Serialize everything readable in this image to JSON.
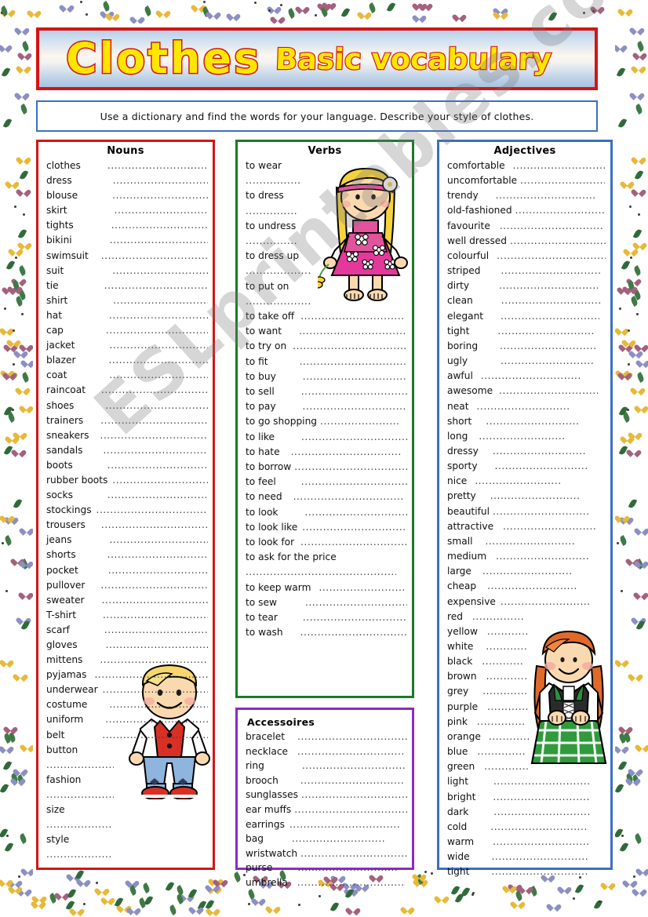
{
  "title": {
    "main": "Clothes",
    "sub": "Basic vocabulary"
  },
  "instruction": {
    "text": "Use a dictionary and find the words for your language.  Describe your style of clothes."
  },
  "watermark": {
    "text": "ESLprintables.com"
  },
  "colors": {
    "title_border": "#d31515",
    "title_fill": "#ffe600",
    "instruction_border": "#3b6fc4",
    "nouns_border": "#d31515",
    "verbs_border": "#1a7a28",
    "accessoires_border": "#8a2bc9",
    "adjectives_border": "#3b6fc4"
  },
  "columns": {
    "nouns": {
      "heading": "Nouns",
      "items": [
        {
          "word": "clothes",
          "gap": 34,
          "dots": 180,
          "wrap": false
        },
        {
          "word": "dress",
          "gap": 52,
          "dots": 170,
          "wrap": false
        },
        {
          "word": "blouse",
          "gap": 44,
          "dots": 168,
          "wrap": false
        },
        {
          "word": "skirt",
          "gap": 60,
          "dots": 168,
          "wrap": false
        },
        {
          "word": "tights",
          "gap": 48,
          "dots": 168,
          "wrap": false
        },
        {
          "word": "bikini",
          "gap": 48,
          "dots": 164,
          "wrap": false
        },
        {
          "word": "swimsuit",
          "gap": 16,
          "dots": 182,
          "wrap": false
        },
        {
          "word": "suit",
          "gap": 62,
          "dots": 163,
          "wrap": false
        },
        {
          "word": "tie",
          "gap": 58,
          "dots": 166,
          "wrap": false
        },
        {
          "word": "shirt",
          "gap": 58,
          "dots": 166,
          "wrap": false
        },
        {
          "word": "hat",
          "gap": 60,
          "dots": 164,
          "wrap": false
        },
        {
          "word": "cap",
          "gap": 54,
          "dots": 164,
          "wrap": false
        },
        {
          "word": "jacket",
          "gap": 44,
          "dots": 164,
          "wrap": false
        },
        {
          "word": "blazer",
          "gap": 42,
          "dots": 164,
          "wrap": false
        },
        {
          "word": "coat",
          "gap": 54,
          "dots": 164,
          "wrap": false
        },
        {
          "word": "raincoat",
          "gap": 20,
          "dots": 178,
          "wrap": false
        },
        {
          "word": "shoes",
          "gap": 40,
          "dots": 170,
          "wrap": false
        },
        {
          "word": "trainers",
          "gap": 22,
          "dots": 175,
          "wrap": false
        },
        {
          "word": "sneakers",
          "gap": 14,
          "dots": 178,
          "wrap": false
        },
        {
          "word": "sandals",
          "gap": 26,
          "dots": 172,
          "wrap": false
        },
        {
          "word": "boots",
          "gap": 44,
          "dots": 164,
          "wrap": false
        },
        {
          "word": "rubber boots",
          "gap": 6,
          "dots": 150,
          "wrap": false
        },
        {
          "word": "socks",
          "gap": 44,
          "dots": 160,
          "wrap": false
        },
        {
          "word": "stockings",
          "gap": 6,
          "dots": 178,
          "wrap": false
        },
        {
          "word": "trousers",
          "gap": 20,
          "dots": 176,
          "wrap": false
        },
        {
          "word": "jeans",
          "gap": 48,
          "dots": 164,
          "wrap": false
        },
        {
          "word": "shorts",
          "gap": 40,
          "dots": 164,
          "wrap": false
        },
        {
          "word": "pocket",
          "gap": 38,
          "dots": 164,
          "wrap": false
        },
        {
          "word": "pullover",
          "gap": 20,
          "dots": 170,
          "wrap": false
        },
        {
          "word": "sweater",
          "gap": 22,
          "dots": 170,
          "wrap": false
        },
        {
          "word": "T-shirt",
          "gap": 34,
          "dots": 164,
          "wrap": false
        },
        {
          "word": "scarf",
          "gap": 44,
          "dots": 162,
          "wrap": false
        },
        {
          "word": "gloves",
          "gap": 36,
          "dots": 162,
          "wrap": false
        },
        {
          "word": "mittens",
          "gap": 22,
          "dots": 166,
          "wrap": false
        },
        {
          "word": "pyjamas",
          "gap": 10,
          "dots": 172,
          "wrap": false
        },
        {
          "word": "underwear",
          "gap": 6,
          "dots": 174,
          "wrap": false
        },
        {
          "word": "costume",
          "gap": 28,
          "dots": 170,
          "wrap": false
        },
        {
          "word": "uniform",
          "gap": 28,
          "dots": 172,
          "wrap": false
        },
        {
          "word": "belt",
          "gap": 48,
          "dots": 170,
          "wrap": false
        },
        {
          "word": "button",
          "gap": 0,
          "dots": 86,
          "wrap": true
        },
        {
          "word": "fashion",
          "gap": 0,
          "dots": 86,
          "wrap": true
        },
        {
          "word": "size",
          "gap": 0,
          "dots": 82,
          "wrap": true
        },
        {
          "word": "style",
          "gap": 0,
          "dots": 82,
          "wrap": true
        }
      ]
    },
    "verbs": {
      "heading": "Verbs",
      "items": [
        {
          "word": "to wear",
          "gap": 0,
          "dots": 72,
          "wrap": true
        },
        {
          "word": "to dress",
          "gap": 0,
          "dots": 66,
          "wrap": true
        },
        {
          "word": "to undress",
          "gap": 0,
          "dots": 66,
          "wrap": true
        },
        {
          "word": "to dress up",
          "gap": 0,
          "dots": 82,
          "wrap": true
        },
        {
          "word": "to put on",
          "gap": 0,
          "dots": 82,
          "wrap": true
        },
        {
          "word": "to take off",
          "gap": 8,
          "dots": 134,
          "wrap": false
        },
        {
          "word": "to want",
          "gap": 22,
          "dots": 138,
          "wrap": false
        },
        {
          "word": "to try on",
          "gap": 8,
          "dots": 146,
          "wrap": false
        },
        {
          "word": "to fit",
          "gap": 40,
          "dots": 142,
          "wrap": false
        },
        {
          "word": "to buy",
          "gap": 34,
          "dots": 136,
          "wrap": false
        },
        {
          "word": "to sell",
          "gap": 34,
          "dots": 136,
          "wrap": false
        },
        {
          "word": "to pay",
          "gap": 34,
          "dots": 140,
          "wrap": false
        },
        {
          "word": "to go shopping",
          "gap": 4,
          "dots": 100,
          "wrap": false
        },
        {
          "word": "to like",
          "gap": 34,
          "dots": 136,
          "wrap": false
        },
        {
          "word": "to hate",
          "gap": 14,
          "dots": 140,
          "wrap": false
        },
        {
          "word": "to borrow",
          "gap": 4,
          "dots": 150,
          "wrap": false
        },
        {
          "word": "to feel",
          "gap": 32,
          "dots": 140,
          "wrap": false
        },
        {
          "word": "to need",
          "gap": 14,
          "dots": 142,
          "wrap": false
        },
        {
          "word": "to look",
          "gap": 34,
          "dots": 136,
          "wrap": false
        },
        {
          "word": "to look like",
          "gap": 6,
          "dots": 148,
          "wrap": false
        },
        {
          "word": "to look for",
          "gap": 8,
          "dots": 144,
          "wrap": false
        },
        {
          "word": "to ask for the price",
          "gap": 0,
          "dots": 192,
          "wrap": true
        },
        {
          "word": "to keep warm",
          "gap": 10,
          "dots": 112,
          "wrap": false
        },
        {
          "word": "to sew",
          "gap": 36,
          "dots": 136,
          "wrap": false
        },
        {
          "word": "to tear",
          "gap": 32,
          "dots": 142,
          "wrap": false
        },
        {
          "word": "to wash",
          "gap": 22,
          "dots": 140,
          "wrap": false
        }
      ]
    },
    "accessoires": {
      "heading": "Accessoires",
      "items": [
        {
          "word": "bracelet",
          "gap": 16,
          "dots": 140,
          "wrap": false
        },
        {
          "word": "necklace",
          "gap": 12,
          "dots": 136,
          "wrap": false
        },
        {
          "word": "ring",
          "gap": 48,
          "dots": 132,
          "wrap": false
        },
        {
          "word": "brooch",
          "gap": 28,
          "dots": 132,
          "wrap": false
        },
        {
          "word": "sunglasses",
          "gap": 4,
          "dots": 140,
          "wrap": false
        },
        {
          "word": "ear muffs",
          "gap": 4,
          "dots": 148,
          "wrap": false
        },
        {
          "word": "earrings",
          "gap": 6,
          "dots": 142,
          "wrap": false
        },
        {
          "word": "bag",
          "gap": 36,
          "dots": 120,
          "wrap": false
        },
        {
          "word": "wristwatch",
          "gap": 4,
          "dots": 148,
          "wrap": false
        },
        {
          "word": "purse",
          "gap": 32,
          "dots": 128,
          "wrap": false
        },
        {
          "word": "umbrella",
          "gap": 12,
          "dots": 136,
          "wrap": false
        }
      ]
    },
    "adjectives": {
      "heading": "Adjectives",
      "items": [
        {
          "word": "comfortable",
          "gap": 10,
          "dots": 118,
          "wrap": false
        },
        {
          "word": "uncomfortable",
          "gap": 4,
          "dots": 108,
          "wrap": false
        },
        {
          "word": "trendy",
          "gap": 22,
          "dots": 128,
          "wrap": false
        },
        {
          "word": "old-fashioned",
          "gap": 4,
          "dots": 114,
          "wrap": false
        },
        {
          "word": "favourite",
          "gap": 12,
          "dots": 132,
          "wrap": false
        },
        {
          "word": "well dressed",
          "gap": 4,
          "dots": 126,
          "wrap": false
        },
        {
          "word": "colourful",
          "gap": 10,
          "dots": 140,
          "wrap": false
        },
        {
          "word": "striped",
          "gap": 26,
          "dots": 128,
          "wrap": false
        },
        {
          "word": "dirty",
          "gap": 38,
          "dots": 126,
          "wrap": false
        },
        {
          "word": "clean",
          "gap": 36,
          "dots": 126,
          "wrap": false
        },
        {
          "word": "elegant",
          "gap": 22,
          "dots": 126,
          "wrap": false
        },
        {
          "word": "tight",
          "gap": 36,
          "dots": 124,
          "wrap": false
        },
        {
          "word": "boring",
          "gap": 28,
          "dots": 124,
          "wrap": false
        },
        {
          "word": "ugly",
          "gap": 42,
          "dots": 120,
          "wrap": false
        },
        {
          "word": "awful",
          "gap": 10,
          "dots": 128,
          "wrap": false
        },
        {
          "word": "awesome",
          "gap": 8,
          "dots": 126,
          "wrap": false
        },
        {
          "word": "neat",
          "gap": 10,
          "dots": 118,
          "wrap": false
        },
        {
          "word": "short",
          "gap": 18,
          "dots": 118,
          "wrap": false
        },
        {
          "word": "long",
          "gap": 14,
          "dots": 112,
          "wrap": false
        },
        {
          "word": "dressy",
          "gap": 18,
          "dots": 118,
          "wrap": false
        },
        {
          "word": "sporty",
          "gap": 22,
          "dots": 118,
          "wrap": false
        },
        {
          "word": "nice",
          "gap": 10,
          "dots": 110,
          "wrap": false
        },
        {
          "word": "pretty",
          "gap": 18,
          "dots": 114,
          "wrap": false
        },
        {
          "word": "beautiful",
          "gap": 4,
          "dots": 122,
          "wrap": false
        },
        {
          "word": "attractive",
          "gap": 12,
          "dots": 118,
          "wrap": false
        },
        {
          "word": "small",
          "gap": 16,
          "dots": 114,
          "wrap": false
        },
        {
          "word": "medium",
          "gap": 12,
          "dots": 118,
          "wrap": false
        },
        {
          "word": "large",
          "gap": 14,
          "dots": 114,
          "wrap": false
        },
        {
          "word": "cheap",
          "gap": 14,
          "dots": 114,
          "wrap": false
        },
        {
          "word": "expensive",
          "gap": 6,
          "dots": 116,
          "wrap": false
        },
        {
          "word": "red",
          "gap": 12,
          "dots": 66,
          "wrap": false
        },
        {
          "word": "yellow",
          "gap": 12,
          "dots": 52,
          "wrap": false
        },
        {
          "word": "white",
          "gap": 16,
          "dots": 52,
          "wrap": false
        },
        {
          "word": "black",
          "gap": 12,
          "dots": 52,
          "wrap": false
        },
        {
          "word": "brown",
          "gap": 12,
          "dots": 52,
          "wrap": false
        },
        {
          "word": "grey",
          "gap": 18,
          "dots": 56,
          "wrap": false
        },
        {
          "word": "purple",
          "gap": 12,
          "dots": 52,
          "wrap": false
        },
        {
          "word": "pink",
          "gap": 12,
          "dots": 62,
          "wrap": false
        },
        {
          "word": "orange",
          "gap": 10,
          "dots": 52,
          "wrap": false
        },
        {
          "word": "blue",
          "gap": 12,
          "dots": 62,
          "wrap": false
        },
        {
          "word": "green",
          "gap": 12,
          "dots": 56,
          "wrap": false
        },
        {
          "word": "light",
          "gap": 32,
          "dots": 122,
          "wrap": false
        },
        {
          "word": "bright",
          "gap": 22,
          "dots": 124,
          "wrap": false
        },
        {
          "word": "dark",
          "gap": 32,
          "dots": 124,
          "wrap": false
        },
        {
          "word": "cold",
          "gap": 30,
          "dots": 124,
          "wrap": false
        },
        {
          "word": "warm",
          "gap": 24,
          "dots": 124,
          "wrap": false
        },
        {
          "word": "wide",
          "gap": 28,
          "dots": 124,
          "wrap": false
        },
        {
          "word": "tight",
          "gap": 28,
          "dots": 124,
          "wrap": false
        }
      ]
    }
  },
  "clipart": [
    {
      "name": "girl-pink-dress-illustration"
    },
    {
      "name": "boy-red-vest-illustration"
    },
    {
      "name": "girl-green-plaid-dress-illustration"
    }
  ]
}
